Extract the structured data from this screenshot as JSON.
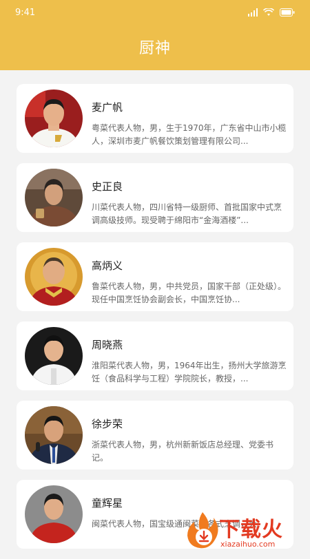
{
  "status": {
    "time": "9:41"
  },
  "header": {
    "title": "厨神"
  },
  "chefs": [
    {
      "name": "麦广帆",
      "description": "粤菜代表人物，男，生于1970年，广东省中山市小榄人，深圳市麦广帆餐饮策划管理有限公司..."
    },
    {
      "name": "史正良",
      "description": "川菜代表人物，四川省特一级厨师、首批国家中式烹调高级技师。现受聘于绵阳市“金海酒楼”..."
    },
    {
      "name": "高炳义",
      "description": "鲁菜代表人物，男，中共党员，国家干部（正处级）。现任中国烹饪协会副会长，中国烹饪协..."
    },
    {
      "name": "周晓燕",
      "description": "淮阳菜代表人物，男，1964年出生，扬州大学旅游烹饪（食品科学与工程）学院院长，教授，..."
    },
    {
      "name": "徐步荣",
      "description": "浙菜代表人物，男，杭州新新饭店总经理、党委书记。"
    },
    {
      "name": "童辉星",
      "description": "闽菜代表人物，国宝级通闽菜的各式烹调，大"
    }
  ],
  "watermark": {
    "text": "下载火",
    "sub": "xiazaihuo.com"
  },
  "colors": {
    "header": "#eebf4b",
    "background": "#f3f3f3",
    "watermark": "#e33a21"
  }
}
